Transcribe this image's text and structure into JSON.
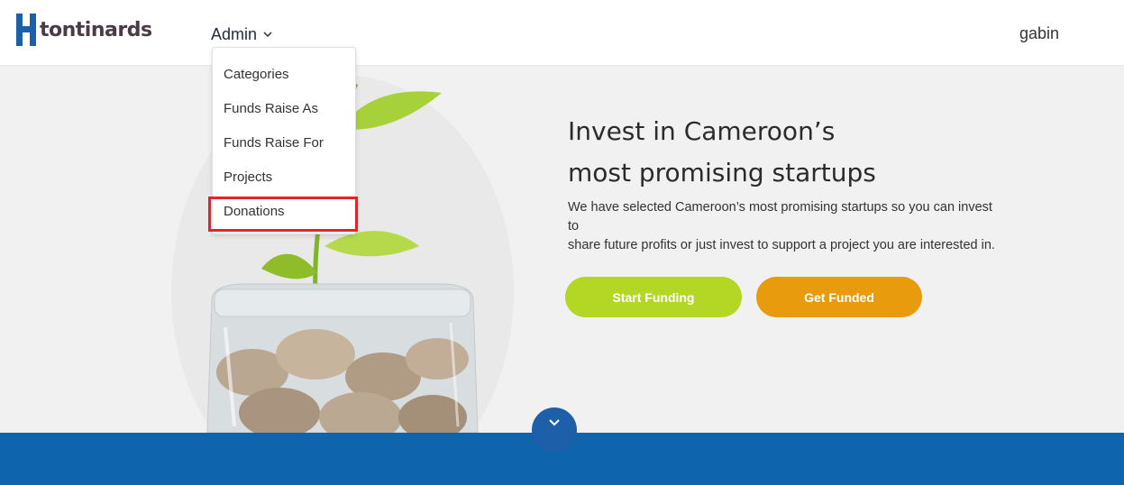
{
  "header": {
    "logo_text": "tontinards",
    "nav_admin": "Admin",
    "user_name": "gabin"
  },
  "admin_menu": {
    "items": [
      {
        "label": "Categories"
      },
      {
        "label": "Funds Raise As"
      },
      {
        "label": "Funds Raise For"
      },
      {
        "label": "Projects"
      },
      {
        "label": "Donations",
        "highlighted": true
      }
    ]
  },
  "hero": {
    "headline_line1": "Invest in Cameroon’s",
    "headline_line2": "most promising startups",
    "lead_line1": "We have selected Cameroon’s most promising startups so you can invest to",
    "lead_line2": "share future profits or just invest to support a project you are interested in.",
    "start_funding": "Start Funding",
    "get_funded": "Get Funded"
  },
  "colors": {
    "brand_blue": "#1d5fa8",
    "band_blue": "#0f64ae",
    "start_green": "#b3d724",
    "funded_orange": "#e99b0e",
    "highlight_red": "#e3242b"
  },
  "icons": {
    "admin_chevron": "chevron-down-icon",
    "scroll_down": "chevron-down-icon",
    "hero_image": "coin-jar-plant-illustration"
  }
}
